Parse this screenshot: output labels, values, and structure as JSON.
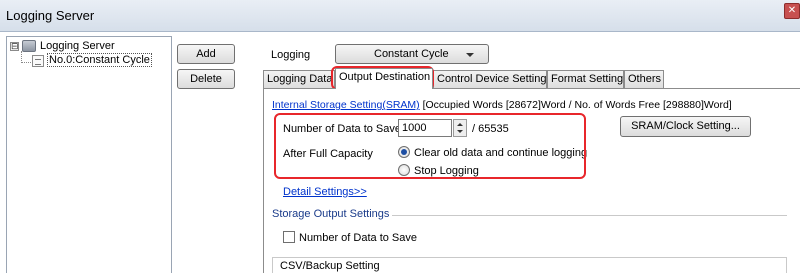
{
  "window": {
    "title": "Logging Server",
    "close_glyph": "✕"
  },
  "tree": {
    "expander": "⊟",
    "root_label": "Logging Server",
    "child_label": "No.0:Constant Cycle"
  },
  "buttons": {
    "add": "Add",
    "delete": "Delete"
  },
  "logging": {
    "label": "Logging",
    "mode": "Constant Cycle"
  },
  "tabs": [
    {
      "label": "Logging Data"
    },
    {
      "label": "Output Destination"
    },
    {
      "label": "Control Device Setting"
    },
    {
      "label": "Format Setting"
    },
    {
      "label": "Others"
    }
  ],
  "output": {
    "sram_link": "Internal Storage Setting(SRAM)",
    "sram_info": " [Occupied Words [28672]Word / No. of Words Free [298880]Word]",
    "num_data_label": "Number of Data to Save",
    "num_data_value": "1000",
    "num_data_max": "/ 65535",
    "sram_clock_button": "SRAM/Clock Setting...",
    "after_full_label": "After Full Capacity",
    "option_clear": "Clear old data and continue logging",
    "option_stop": "Stop Logging",
    "selected_option": "Clear old data and continue logging",
    "detail_link": "Detail Settings>>",
    "storage_title": "Storage Output Settings",
    "storage_checkbox_label": "Number of Data to Save",
    "csv_title": "CSV/Backup Setting"
  },
  "colors": {
    "highlight": "#e8262b",
    "link": "#0033cc",
    "section": "#1a3b8a"
  }
}
